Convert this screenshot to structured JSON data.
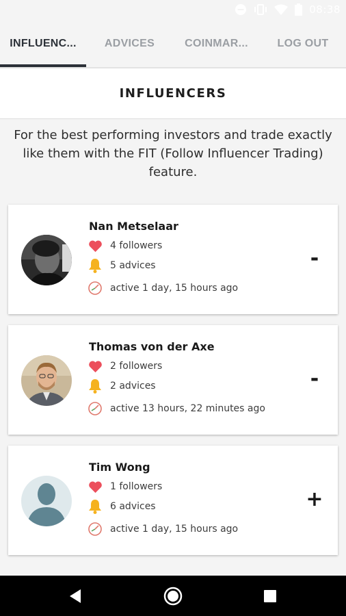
{
  "status_bar": {
    "time": "08:38",
    "icons": [
      "minus-circle-icon",
      "vibrate-icon",
      "wifi-icon",
      "battery-icon"
    ]
  },
  "tabs": [
    {
      "label": "INFLUENC...",
      "active": true
    },
    {
      "label": "ADVICES",
      "active": false
    },
    {
      "label": "COINMAR...",
      "active": false
    },
    {
      "label": "LOG OUT",
      "active": false
    }
  ],
  "header": {
    "title": "INFLUENCERS"
  },
  "intro": "For the best performing investors and trade exactly like them with the FIT (Follow Influencer Trading) feature.",
  "influencers": [
    {
      "name": "Nan Metselaar",
      "followers": "4 followers",
      "advices": "5 advices",
      "active": "active 1 day, 15 hours ago",
      "action": "-"
    },
    {
      "name": "Thomas von der Axe",
      "followers": "2 followers",
      "advices": "2 advices",
      "active": "active 13 hours, 22 minutes ago",
      "action": "-"
    },
    {
      "name": "Tim Wong",
      "followers": "1 followers",
      "advices": "6 advices",
      "active": "active 1 day, 15 hours ago",
      "action": "+"
    }
  ],
  "nav": {
    "icons": [
      "back-icon",
      "home-icon",
      "recents-icon"
    ]
  },
  "colors": {
    "accent": "#2c3138",
    "heart": "#ec4f5c",
    "bell": "#f5b21f",
    "tab_inactive": "#9a9ea3"
  }
}
